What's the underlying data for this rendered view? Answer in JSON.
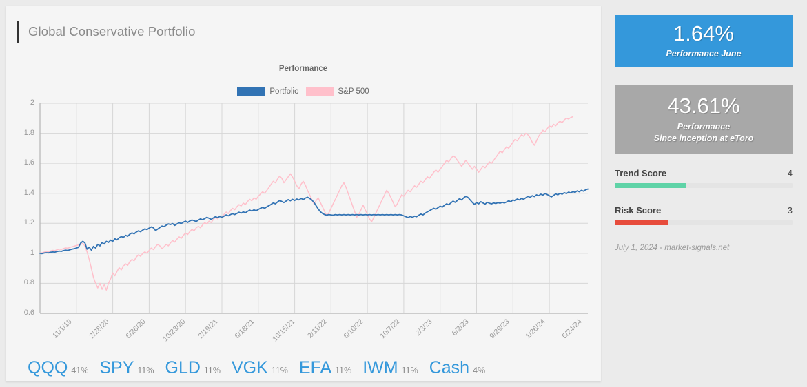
{
  "page_title": "Global Conservative Portfolio",
  "chart": {
    "title": "Performance",
    "legend": [
      {
        "label": "Portfolio",
        "color": "#3273b4"
      },
      {
        "label": "S&P 500",
        "color": "#ffc0cb"
      }
    ]
  },
  "holdings": [
    {
      "ticker": "QQQ",
      "pct": "41%"
    },
    {
      "ticker": "SPY",
      "pct": "11%"
    },
    {
      "ticker": "GLD",
      "pct": "11%"
    },
    {
      "ticker": "VGK",
      "pct": "11%"
    },
    {
      "ticker": "EFA",
      "pct": "11%"
    },
    {
      "ticker": "IWM",
      "pct": "11%"
    },
    {
      "ticker": "Cash",
      "pct": "4%"
    }
  ],
  "sidebar": {
    "month_card": {
      "value": "1.64%",
      "caption": "Performance June",
      "color": "#3498db"
    },
    "inception_card": {
      "value": "43.61%",
      "caption_line1": "Performance",
      "caption_line2": "Since inception at eToro",
      "color": "#a8a8a8"
    },
    "scores": [
      {
        "id": "trend",
        "label": "Trend Score",
        "value": "4",
        "max": 10,
        "color": "#5fd3a7"
      },
      {
        "id": "risk",
        "label": "Risk Score",
        "value": "3",
        "max": 10,
        "color": "#e74c3c"
      }
    ],
    "footer": "July 1, 2024 - market-signals.net"
  },
  "chart_data": {
    "type": "line",
    "title": "Performance",
    "xlabel": "",
    "ylabel": "",
    "ylim": [
      0.6,
      2.0
    ],
    "yticks": [
      0.6,
      0.8,
      1.0,
      1.2,
      1.4,
      1.6,
      1.8,
      2.0
    ],
    "ytick_labels": [
      "0.6",
      "0.8",
      "1",
      "1.2",
      "1.4",
      "1.6",
      "1.8",
      "2"
    ],
    "grid": true,
    "legend_position": "top-center",
    "x_tick_labels": [
      "11/1/19",
      "2/28/20",
      "6/26/20",
      "10/23/20",
      "2/19/21",
      "6/18/21",
      "10/15/21",
      "2/11/22",
      "6/10/22",
      "10/7/22",
      "2/3/23",
      "6/2/23",
      "9/29/23",
      "1/26/24",
      "5/24/24"
    ],
    "x_tick_index": [
      0,
      17,
      34,
      51,
      68,
      85,
      102,
      119,
      136,
      153,
      170,
      187,
      204,
      221,
      238
    ],
    "n_points": 245,
    "series": [
      {
        "name": "Portfolio",
        "color": "#3273b4",
        "values": [
          1.0,
          0.998,
          1.002,
          1.004,
          1.003,
          1.007,
          1.009,
          1.008,
          1.012,
          1.015,
          1.013,
          1.018,
          1.021,
          1.019,
          1.024,
          1.028,
          1.031,
          1.035,
          1.04,
          1.068,
          1.08,
          1.07,
          1.028,
          1.041,
          1.022,
          1.046,
          1.035,
          1.06,
          1.05,
          1.072,
          1.062,
          1.08,
          1.073,
          1.088,
          1.08,
          1.097,
          1.09,
          1.104,
          1.112,
          1.106,
          1.12,
          1.114,
          1.128,
          1.136,
          1.13,
          1.142,
          1.15,
          1.144,
          1.155,
          1.163,
          1.158,
          1.168,
          1.176,
          1.17,
          1.152,
          1.162,
          1.172,
          1.182,
          1.178,
          1.188,
          1.196,
          1.192,
          1.198,
          1.186,
          1.196,
          1.204,
          1.198,
          1.208,
          1.214,
          1.206,
          1.216,
          1.222,
          1.218,
          1.212,
          1.222,
          1.23,
          1.224,
          1.232,
          1.24,
          1.234,
          1.226,
          1.236,
          1.244,
          1.238,
          1.246,
          1.24,
          1.248,
          1.256,
          1.25,
          1.258,
          1.264,
          1.258,
          1.266,
          1.274,
          1.268,
          1.276,
          1.27,
          1.28,
          1.288,
          1.282,
          1.29,
          1.284,
          1.292,
          1.3,
          1.306,
          1.3,
          1.31,
          1.318,
          1.326,
          1.336,
          1.33,
          1.342,
          1.352,
          1.346,
          1.338,
          1.348,
          1.358,
          1.35,
          1.36,
          1.352,
          1.362,
          1.356,
          1.366,
          1.358,
          1.368,
          1.374,
          1.366,
          1.356,
          1.34,
          1.318,
          1.296,
          1.278,
          1.266,
          1.258,
          1.254,
          1.258,
          1.256,
          1.254,
          1.258,
          1.256,
          1.258,
          1.256,
          1.258,
          1.256,
          1.258,
          1.256,
          1.258,
          1.256,
          1.258,
          1.256,
          1.258,
          1.256,
          1.258,
          1.256,
          1.258,
          1.256,
          1.258,
          1.256,
          1.258,
          1.256,
          1.258,
          1.256,
          1.258,
          1.256,
          1.258,
          1.256,
          1.258,
          1.256,
          1.258,
          1.256,
          1.25,
          1.244,
          1.238,
          1.246,
          1.24,
          1.248,
          1.244,
          1.254,
          1.262,
          1.256,
          1.268,
          1.276,
          1.284,
          1.292,
          1.3,
          1.294,
          1.304,
          1.314,
          1.308,
          1.32,
          1.33,
          1.324,
          1.336,
          1.348,
          1.34,
          1.352,
          1.364,
          1.356,
          1.37,
          1.38,
          1.372,
          1.356,
          1.34,
          1.326,
          1.338,
          1.33,
          1.344,
          1.336,
          1.328,
          1.34,
          1.334,
          1.33,
          1.336,
          1.332,
          1.338,
          1.334,
          1.34,
          1.336,
          1.342,
          1.35,
          1.344,
          1.356,
          1.35,
          1.362,
          1.356,
          1.366,
          1.36,
          1.37,
          1.38,
          1.372,
          1.384,
          1.378,
          1.39,
          1.384,
          1.394,
          1.388,
          1.398,
          1.392,
          1.384,
          1.376,
          1.386,
          1.396,
          1.39,
          1.4,
          1.394,
          1.404,
          1.398,
          1.408,
          1.402,
          1.412,
          1.406,
          1.416,
          1.41,
          1.42,
          1.414,
          1.424,
          1.428
        ]
      },
      {
        "name": "S&P 500",
        "color": "#ffc0cb",
        "values": [
          1.0,
          1.004,
          1.008,
          1.012,
          1.01,
          1.016,
          1.02,
          1.018,
          1.024,
          1.028,
          1.026,
          1.032,
          1.036,
          1.034,
          1.04,
          1.044,
          1.048,
          1.052,
          1.056,
          1.06,
          1.066,
          1.05,
          1.01,
          0.96,
          0.9,
          0.84,
          0.8,
          0.77,
          0.8,
          0.76,
          0.79,
          0.755,
          0.8,
          0.83,
          0.87,
          0.85,
          0.88,
          0.905,
          0.89,
          0.915,
          0.93,
          0.92,
          0.945,
          0.96,
          0.95,
          0.975,
          0.99,
          0.98,
          1.0,
          1.01,
          1.0,
          1.02,
          1.035,
          1.025,
          1.045,
          1.06,
          1.05,
          1.03,
          1.045,
          1.06,
          1.05,
          1.07,
          1.085,
          1.075,
          1.095,
          1.11,
          1.1,
          1.12,
          1.135,
          1.125,
          1.145,
          1.16,
          1.15,
          1.17,
          1.18,
          1.17,
          1.19,
          1.205,
          1.195,
          1.215,
          1.205,
          1.225,
          1.24,
          1.23,
          1.25,
          1.24,
          1.26,
          1.275,
          1.265,
          1.285,
          1.3,
          1.29,
          1.31,
          1.325,
          1.315,
          1.335,
          1.325,
          1.345,
          1.36,
          1.35,
          1.37,
          1.36,
          1.38,
          1.395,
          1.41,
          1.4,
          1.42,
          1.44,
          1.46,
          1.48,
          1.47,
          1.495,
          1.515,
          1.5,
          1.47,
          1.49,
          1.51,
          1.53,
          1.51,
          1.48,
          1.45,
          1.43,
          1.46,
          1.48,
          1.455,
          1.42,
          1.39,
          1.36,
          1.33,
          1.35,
          1.37,
          1.34,
          1.31,
          1.28,
          1.25,
          1.27,
          1.3,
          1.33,
          1.36,
          1.39,
          1.42,
          1.45,
          1.47,
          1.44,
          1.4,
          1.36,
          1.32,
          1.28,
          1.24,
          1.26,
          1.29,
          1.32,
          1.29,
          1.26,
          1.23,
          1.21,
          1.24,
          1.27,
          1.3,
          1.33,
          1.36,
          1.39,
          1.42,
          1.4,
          1.37,
          1.34,
          1.31,
          1.33,
          1.36,
          1.39,
          1.38,
          1.4,
          1.42,
          1.41,
          1.43,
          1.45,
          1.44,
          1.46,
          1.48,
          1.47,
          1.49,
          1.51,
          1.5,
          1.52,
          1.54,
          1.555,
          1.54,
          1.56,
          1.58,
          1.6,
          1.62,
          1.61,
          1.63,
          1.65,
          1.64,
          1.62,
          1.6,
          1.58,
          1.6,
          1.62,
          1.6,
          1.58,
          1.56,
          1.58,
          1.56,
          1.54,
          1.56,
          1.58,
          1.57,
          1.59,
          1.61,
          1.6,
          1.62,
          1.64,
          1.66,
          1.68,
          1.67,
          1.69,
          1.71,
          1.7,
          1.72,
          1.74,
          1.76,
          1.75,
          1.77,
          1.79,
          1.78,
          1.8,
          1.79,
          1.77,
          1.74,
          1.72,
          1.75,
          1.78,
          1.8,
          1.82,
          1.81,
          1.83,
          1.85,
          1.84,
          1.86,
          1.85,
          1.87,
          1.88,
          1.87,
          1.89,
          1.9,
          1.895,
          1.905,
          1.91
        ]
      }
    ]
  }
}
